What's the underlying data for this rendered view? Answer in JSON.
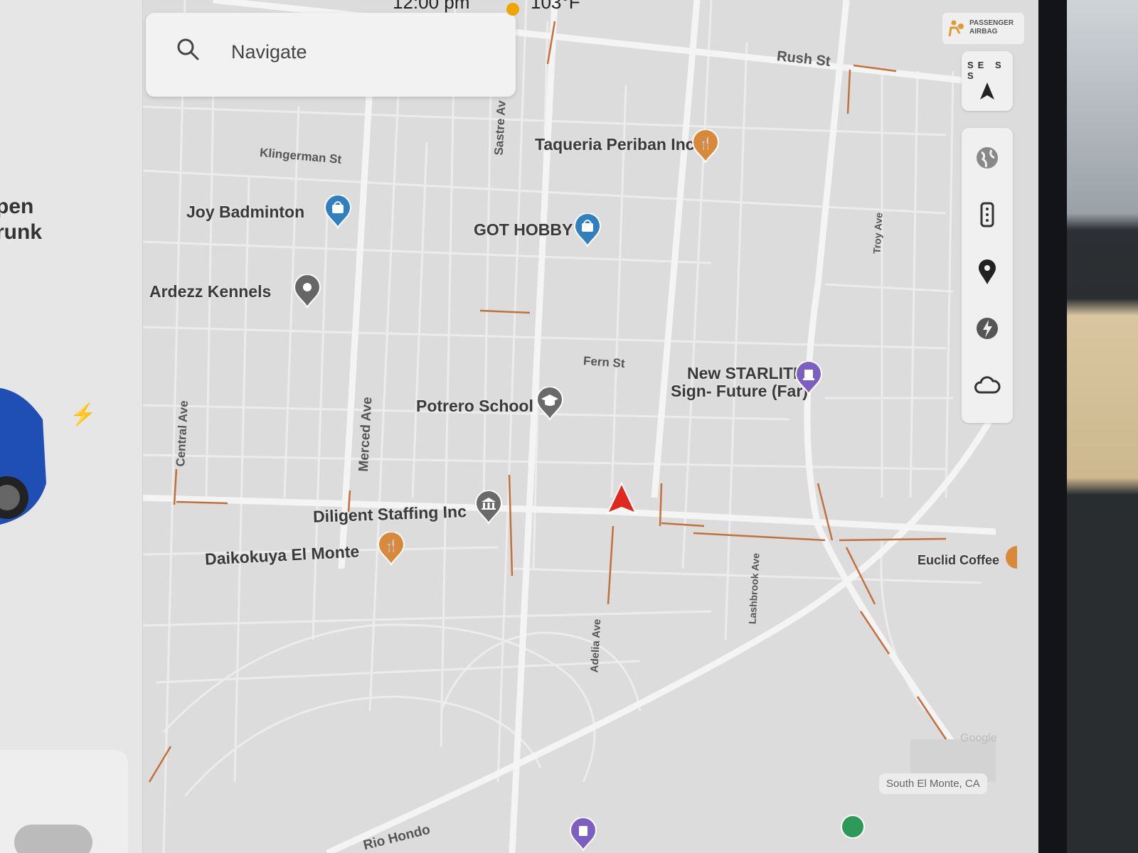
{
  "status": {
    "time": "12:00 pm",
    "temperature": "103°F"
  },
  "search": {
    "label": "Navigate"
  },
  "left_panel": {
    "line1": "pen",
    "line2": "runk"
  },
  "airbag": {
    "line1": "PASSENGER",
    "line2": "AIRBAG"
  },
  "compass": {
    "letters": "SE S S"
  },
  "toolbar": {
    "items": [
      "globe-icon",
      "stack-icon",
      "pin-icon",
      "lightning-icon",
      "cloud-icon"
    ]
  },
  "pois": [
    {
      "name": "Taqueria Periban Inc",
      "type": "restaurant"
    },
    {
      "name": "Joy Badminton",
      "type": "shopping"
    },
    {
      "name": "GOT HOBBY",
      "type": "shopping"
    },
    {
      "name": "Ardezz Kennels",
      "type": "generic"
    },
    {
      "name": "New STARLITE",
      "name2": "Sign- Future (Far)",
      "type": "landmark"
    },
    {
      "name": "Potrero School",
      "type": "school"
    },
    {
      "name": "Diligent Staffing Inc",
      "type": "government"
    },
    {
      "name": "Daikokuya El Monte",
      "type": "restaurant"
    },
    {
      "name": "Euclid Coffee",
      "type": "restaurant"
    }
  ],
  "streets": [
    "Rush St",
    "Klingerman St",
    "Sastre Av",
    "Troy Ave",
    "Fern St",
    "Central Ave",
    "Merced Ave",
    "Adelia Ave",
    "Lashbrook Ave",
    "Rio Hondo"
  ],
  "area": {
    "label": "South El Monte, CA"
  },
  "attribution": {
    "label": "Google"
  },
  "colors": {
    "map_bg": "#dcdcdc",
    "road": "#f3f3f3",
    "traffic": "#c4703a",
    "poi_blue": "#2f7fc1",
    "poi_orange": "#d8893a",
    "poi_gray": "#666666",
    "poi_purple": "#7b5fc2",
    "nav_arrow": "#e0281e"
  }
}
